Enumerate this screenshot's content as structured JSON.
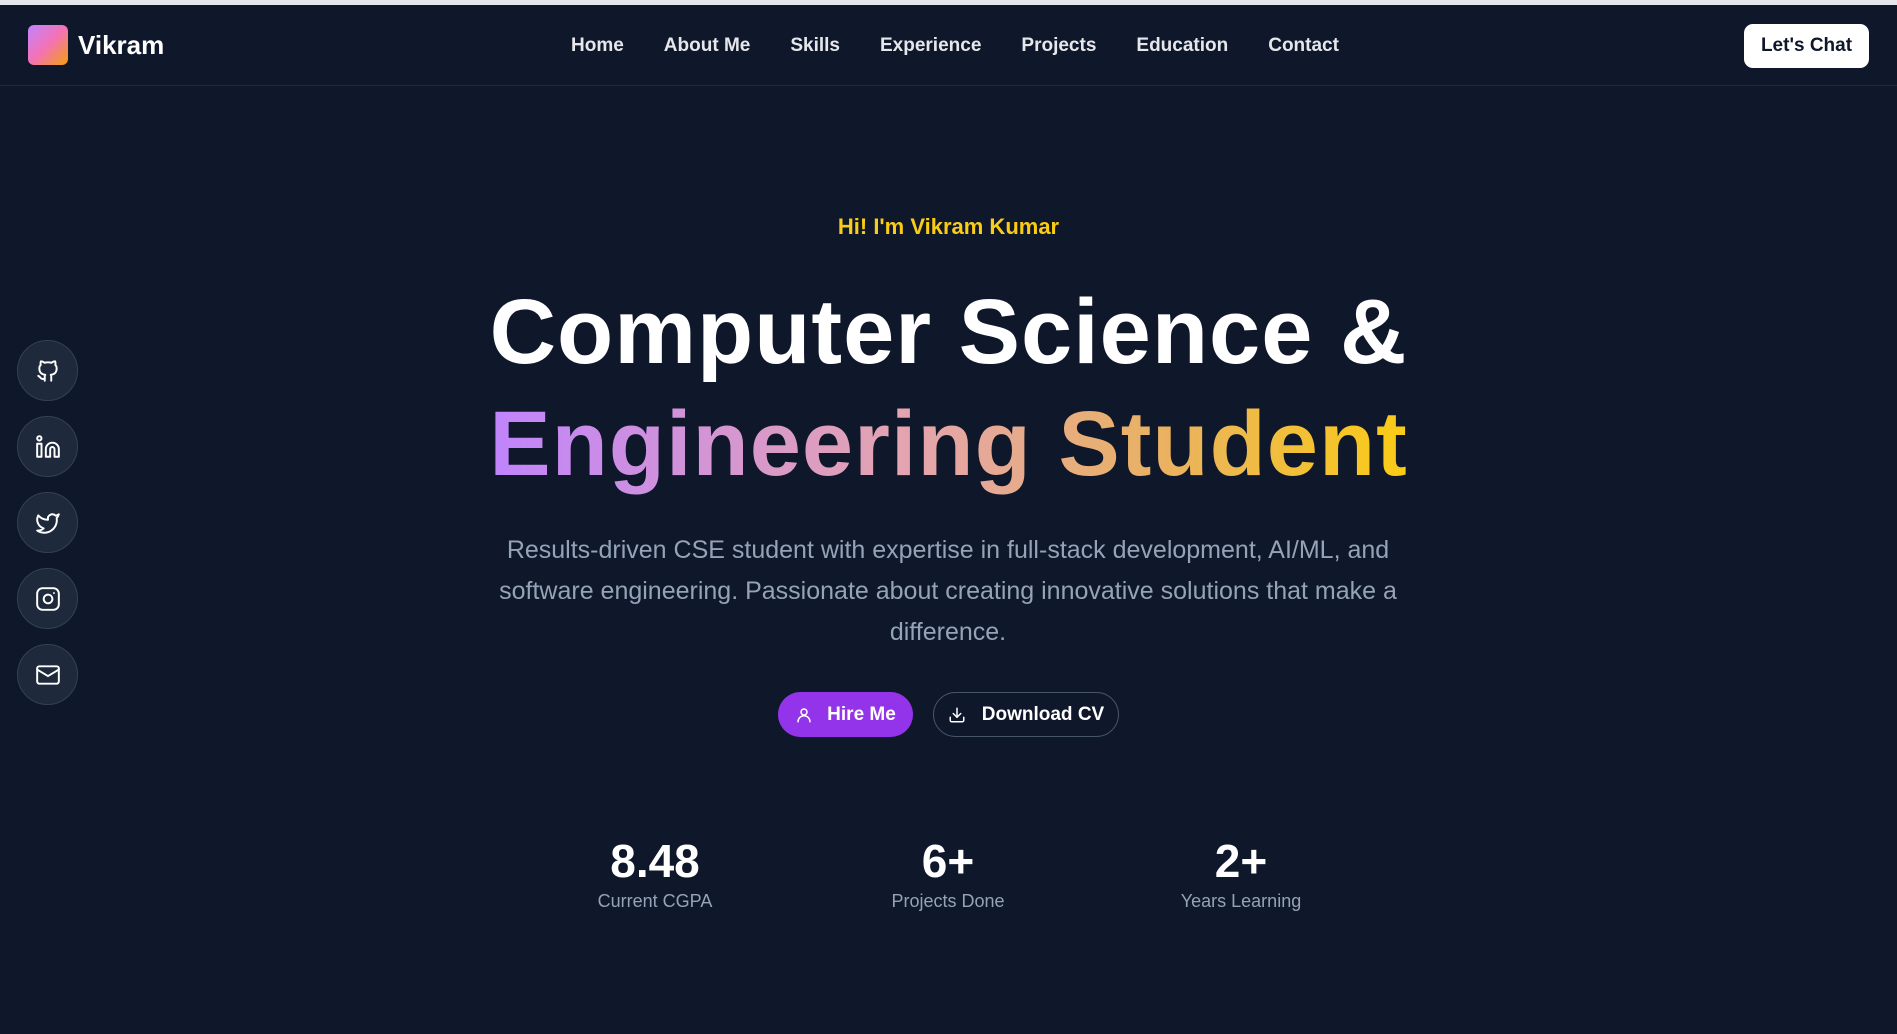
{
  "brand": {
    "name": "Vikram"
  },
  "nav": {
    "links": [
      "Home",
      "About Me",
      "Skills",
      "Experience",
      "Projects",
      "Education",
      "Contact"
    ],
    "cta": "Let's Chat"
  },
  "socials": [
    {
      "icon": "github-icon"
    },
    {
      "icon": "linkedin-icon"
    },
    {
      "icon": "twitter-icon"
    },
    {
      "icon": "instagram-icon"
    },
    {
      "icon": "mail-icon"
    }
  ],
  "hero": {
    "greeting": "Hi! I'm Vikram Kumar",
    "title_line1": "Computer Science &",
    "title_line2": "Engineering Student",
    "description": "Results-driven CSE student with expertise in full-stack development, AI/ML, and software engineering. Passionate about creating innovative solutions that make a difference.",
    "hire_label": "Hire Me",
    "download_label": "Download CV"
  },
  "stats": [
    {
      "value": "8.48",
      "label": "Current CGPA"
    },
    {
      "value": "6+",
      "label": "Projects Done"
    },
    {
      "value": "2+",
      "label": "Years Learning"
    }
  ],
  "colors": {
    "background": "#0f172a",
    "accent_purple": "#9333ea",
    "accent_yellow": "#facc15",
    "muted_text": "#94a3b8"
  }
}
